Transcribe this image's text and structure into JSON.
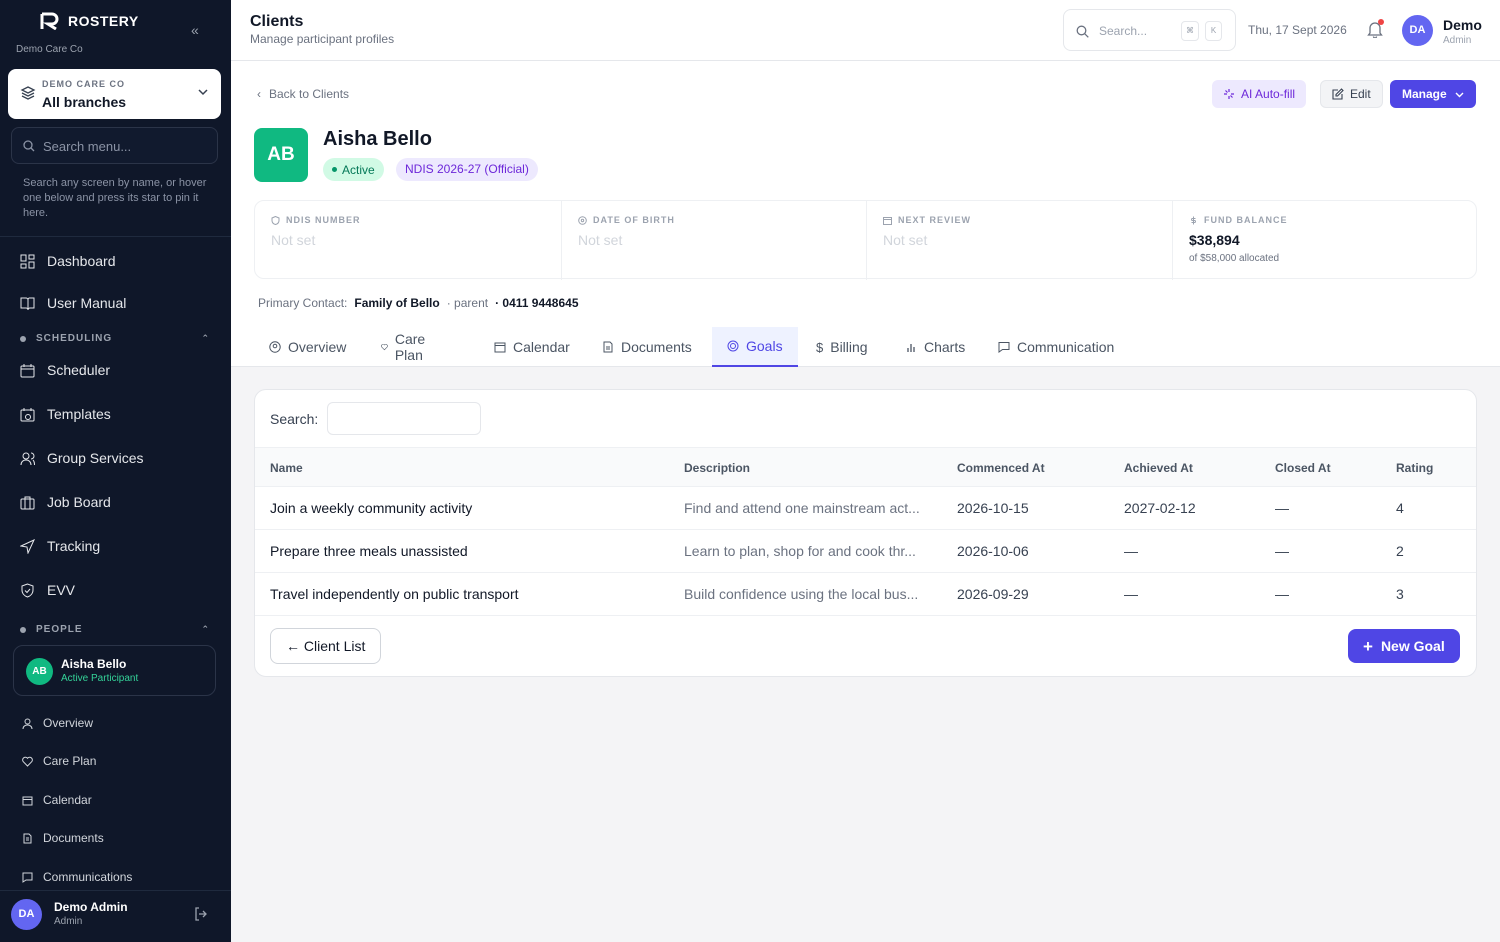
{
  "brand": {
    "name": "ROSTERY",
    "org": "Demo Care Co"
  },
  "branch_selector": {
    "label": "DEMO CARE CO",
    "value": "All branches"
  },
  "menu_search": {
    "placeholder": "Search menu...",
    "hint": "Search any screen by name, or hover one below and press its star to pin it here."
  },
  "nav": {
    "dashboard": "Dashboard",
    "user_manual": "User Manual",
    "scheduling_header": "SCHEDULING",
    "scheduler": "Scheduler",
    "templates": "Templates",
    "group_services": "Group Services",
    "job_board": "Job Board",
    "tracking": "Tracking",
    "evv": "EVV",
    "people_header": "PEOPLE"
  },
  "person_card": {
    "initials": "AB",
    "name": "Aisha Bello",
    "status": "Active Participant"
  },
  "sub_nav": {
    "overview": "Overview",
    "care_plan": "Care Plan",
    "calendar": "Calendar",
    "documents": "Documents",
    "communications": "Communications"
  },
  "sidebar_user": {
    "initials": "DA",
    "name": "Demo Admin",
    "role": "Admin"
  },
  "topbar": {
    "title": "Clients",
    "subtitle": "Manage participant profiles",
    "search_placeholder": "Search...",
    "kbd1": "⌘",
    "kbd2": "K",
    "date": "Thu, 17 Sept 2026",
    "user_initials": "DA",
    "user_name": "Demo",
    "user_role": "Admin"
  },
  "header": {
    "back_label": "Back to Clients",
    "ai_label": "AI Auto-fill",
    "edit_label": "Edit",
    "manage_label": "Manage"
  },
  "client": {
    "initials": "AB",
    "name": "Aisha Bello",
    "status": "Active",
    "plan": "NDIS 2026-27 (Official)"
  },
  "info": {
    "ndis_label": "NDIS NUMBER",
    "ndis_value": "Not set",
    "dob_label": "DATE OF BIRTH",
    "dob_value": "Not set",
    "review_label": "NEXT REVIEW",
    "review_value": "Not set",
    "fund_label": "FUND BALANCE",
    "fund_value": "$38,894",
    "fund_sub": "of $58,000 allocated"
  },
  "contact": {
    "label": "Primary Contact:",
    "name": "Family of Bello",
    "relation": "· parent",
    "phone": "· 0411 9448645"
  },
  "tabs": {
    "overview": "Overview",
    "care_plan": "Care Plan",
    "calendar": "Calendar",
    "documents": "Documents",
    "goals": "Goals",
    "billing": "Billing",
    "charts": "Charts",
    "communication": "Communication"
  },
  "goals_panel": {
    "search_label": "Search:",
    "columns": {
      "name": "Name",
      "description": "Description",
      "commenced": "Commenced At",
      "achieved": "Achieved At",
      "closed": "Closed At",
      "rating": "Rating"
    },
    "rows": [
      {
        "name": "Join a weekly community activity",
        "description": "Find and attend one mainstream act...",
        "commenced": "2026-10-15",
        "achieved": "2027-02-12",
        "closed": "—",
        "rating": "4"
      },
      {
        "name": "Prepare three meals unassisted",
        "description": "Learn to plan, shop for and cook thr...",
        "commenced": "2026-10-06",
        "achieved": "—",
        "closed": "—",
        "rating": "2"
      },
      {
        "name": "Travel independently on public transport",
        "description": "Build confidence using the local bus...",
        "commenced": "2026-09-29",
        "achieved": "—",
        "closed": "—",
        "rating": "3"
      }
    ],
    "client_list_label": "← Client List",
    "new_goal_label": "New Goal"
  },
  "colors": {
    "accent": "#4f46e5",
    "sidebar_bg": "#0f1729",
    "success": "#10b981"
  }
}
